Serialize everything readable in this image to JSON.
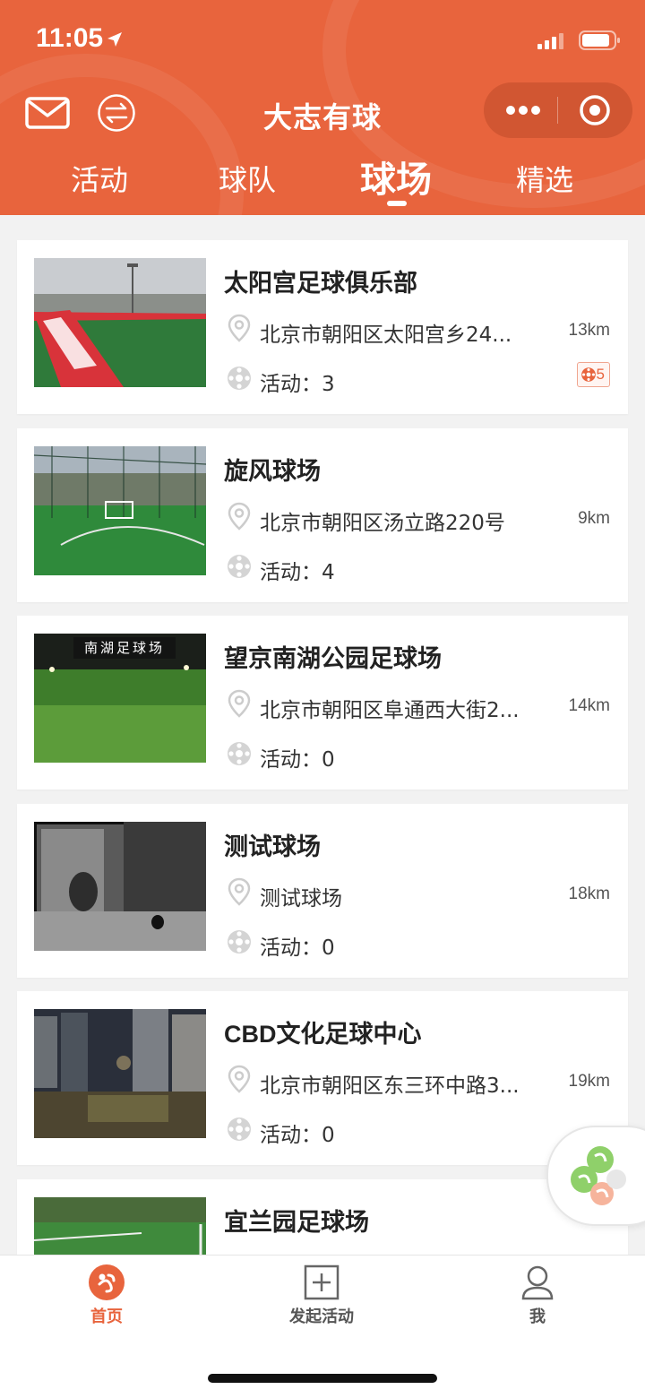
{
  "status": {
    "time": "11:05"
  },
  "header": {
    "title": "大志有球",
    "tabs": [
      {
        "label": "活动",
        "active": false
      },
      {
        "label": "球队",
        "active": false
      },
      {
        "label": "球场",
        "active": true
      },
      {
        "label": "精选",
        "active": false
      }
    ]
  },
  "venues": [
    {
      "name": "太阳宫足球俱乐部",
      "address": "北京市朝阳区太阳宫乡24...",
      "distance": "13km",
      "activity": "活动：3",
      "badge": "5"
    },
    {
      "name": "旋风球场",
      "address": "北京市朝阳区汤立路220号",
      "distance": "9km",
      "activity": "活动：4"
    },
    {
      "name": "望京南湖公园足球场",
      "address": "北京市朝阳区阜通西大街2...",
      "distance": "14km",
      "activity": "活动：0",
      "photo_caption": "南湖足球场"
    },
    {
      "name": "测试球场",
      "address": "测试球场",
      "distance": "18km",
      "activity": "活动：0"
    },
    {
      "name": "CBD文化足球中心",
      "address": "北京市朝阳区东三环中路3...",
      "distance": "19km",
      "activity": "活动：0"
    },
    {
      "name": "宜兰园足球场"
    }
  ],
  "tabbar": {
    "items": [
      {
        "label": "首页",
        "icon": "home-logo-icon",
        "active": true
      },
      {
        "label": "发起活动",
        "icon": "plus-square-icon",
        "active": false
      },
      {
        "label": "我",
        "icon": "user-icon",
        "active": false
      }
    ]
  },
  "colors": {
    "brand": "#e8643d",
    "text": "#333333",
    "muted": "#999999"
  }
}
